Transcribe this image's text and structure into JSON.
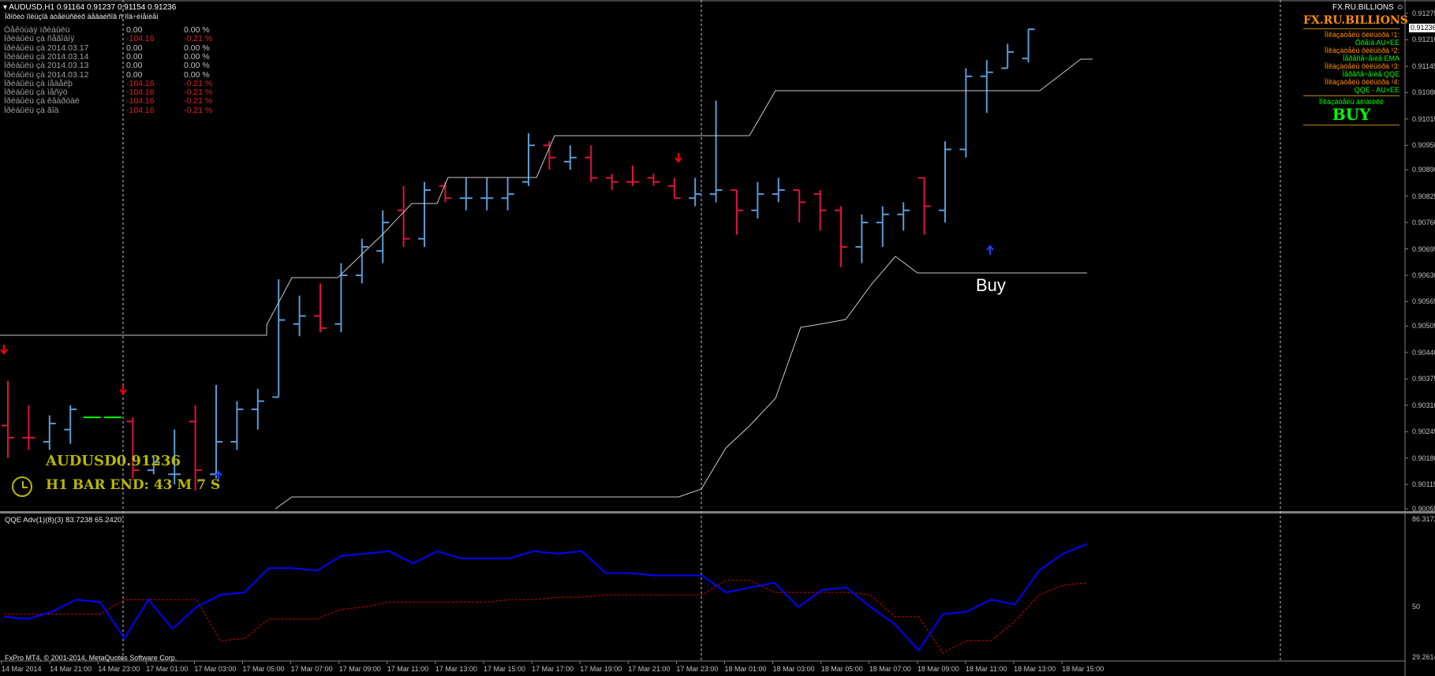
{
  "header": {
    "symbol_line": "AUDUSD,H1  0.91164 0.91237 0.91154 0.91236",
    "subtitle": "Ïðîôèò ïîëüçîâ àòåëüñêèõ äåâàéñîâ ñ ïîä÷èíåíèåì",
    "broker_label": "FX.RU.BILLIONS"
  },
  "stats": {
    "rows": [
      {
        "label": "Òåêóùàÿ ïðèáûëü",
        "value": "0.00",
        "pct": "0.00 %",
        "color": "#c0c0c0"
      },
      {
        "label": "Ïðèáûëü çà ñåãîäíÿ",
        "value": "-104.16",
        "pct": "-0.21 %",
        "color": "#e02020"
      },
      {
        "label": "Ïðèáûëü çà 2014.03.17",
        "value": "0.00",
        "pct": "0.00 %",
        "color": "#c0c0c0"
      },
      {
        "label": "Ïðèáûëü çà 2014.03.14",
        "value": "0.00",
        "pct": "0.00 %",
        "color": "#c0c0c0"
      },
      {
        "label": "Ïðèáûëü çà 2014.03.13",
        "value": "0.00",
        "pct": "0.00 %",
        "color": "#c0c0c0"
      },
      {
        "label": "Ïðèáûëü çà 2014.03.12",
        "value": "0.00",
        "pct": "0.00 %",
        "color": "#c0c0c0"
      },
      {
        "label": "Ïðèáûëü çà íåäåëþ",
        "value": "-104.16",
        "pct": "-0.21 %",
        "color": "#e02020"
      },
      {
        "label": "Ïðèáûëü çà ìåñÿö",
        "value": "-104.16",
        "pct": "-0.21 %",
        "color": "#e02020"
      },
      {
        "label": "Ïðèáûëü çà êâàðòàë",
        "value": "-104.16",
        "pct": "-0.21 %",
        "color": "#e02020"
      },
      {
        "label": "Ïðèáûëü çà ãîä",
        "value": "-104.16",
        "pct": "-0.21 %",
        "color": "#e02020"
      }
    ]
  },
  "overlay": {
    "symbol_price": "AUDUSD0.91236",
    "bar_end": "H1 BAR END: 43 M 7 S",
    "buy_label": "Buy",
    "clock_icon": "clock-icon"
  },
  "right_panel": {
    "title": "FX.RU.BILLIONS",
    "lines": [
      {
        "text": "Ïîêàçàòåëü ôèëüòðà ¹1:",
        "color": "#ff8c00"
      },
      {
        "text": "Òðåíä AU×EE",
        "color": "#00ff00"
      },
      {
        "text": "Ïîêàçàòåëü ôèëüòðà ¹2:",
        "color": "#ff8c00"
      },
      {
        "text": "Ïåðåñå÷åíèå EMA",
        "color": "#00ff00"
      },
      {
        "text": "Ïîêàçàòåëü ôèëüòðà ¹3:",
        "color": "#ff8c00"
      },
      {
        "text": "Ïåðåñå÷åíèå QQE",
        "color": "#00ff00"
      },
      {
        "text": "Ïîêàçàòåëü ôèëüòðà ¹4:",
        "color": "#ff8c00"
      },
      {
        "text": "QQE - AU×EE",
        "color": "#00ff00"
      }
    ],
    "signal_caption": "Ïîêàçàòåëü äèíàìèêè",
    "signal": "BUY"
  },
  "price_axis": {
    "labels": [
      "0.91275",
      "0.91210",
      "0.91145",
      "0.91080",
      "0.91015",
      "0.90950",
      "0.90890",
      "0.90825",
      "0.90760",
      "0.90695",
      "0.90630",
      "0.90565",
      "0.90505",
      "0.90440",
      "0.90375",
      "0.90310",
      "0.90245",
      "0.90180",
      "0.90115",
      "0.90055"
    ],
    "current_price": "0.91236"
  },
  "indicator": {
    "title": "QQE Adv(1)(8)(3) 83.7238 65.2420",
    "axis_labels": [
      "86.3172",
      "50",
      "29.2614"
    ]
  },
  "time_axis": {
    "labels": [
      "14 Mar 2014",
      "14 Mar 21:00",
      "14 Mar 23:00",
      "17 Mar 01:00",
      "17 Mar 03:00",
      "17 Mar 05:00",
      "17 Mar 07:00",
      "17 Mar 09:00",
      "17 Mar 11:00",
      "17 Mar 13:00",
      "17 Mar 15:00",
      "17 Mar 17:00",
      "17 Mar 19:00",
      "17 Mar 21:00",
      "17 Mar 23:00",
      "18 Mar 01:00",
      "18 Mar 03:00",
      "18 Mar 05:00",
      "18 Mar 07:00",
      "18 Mar 09:00",
      "18 Mar 11:00",
      "18 Mar 13:00",
      "18 Mar 15:00"
    ]
  },
  "footer": {
    "copyright": "FxPro MT4, © 2001-2014, MetaQuotes Software Corp."
  },
  "colors": {
    "bull": "#5b9bd5",
    "bear": "#dc143c",
    "qqe_fast": "#0000ff",
    "qqe_slow": "#cc0000",
    "envelope": "#c8c8c8",
    "gold": "#b8b800",
    "green": "#00ff00",
    "orange": "#ff8c00"
  },
  "chart_data": {
    "type": "candlestick",
    "symbol": "AUDUSD",
    "timeframe": "H1",
    "bars": [
      {
        "o": 0.9026,
        "h": 0.9037,
        "l": 0.9018,
        "c": 0.9023,
        "d": "bear"
      },
      {
        "o": 0.9023,
        "h": 0.9031,
        "l": 0.902,
        "c": 0.9023,
        "d": "bear"
      },
      {
        "o": 0.9022,
        "h": 0.90285,
        "l": 0.902,
        "c": 0.90265,
        "d": "bull"
      },
      {
        "o": 0.9025,
        "h": 0.9031,
        "l": 0.90215,
        "c": 0.903,
        "d": "bull"
      },
      {
        "o": 0.9028,
        "h": 0.9028,
        "l": 0.9028,
        "c": 0.9028,
        "d": "green"
      },
      {
        "o": 0.9028,
        "h": 0.9028,
        "l": 0.9028,
        "c": 0.9028,
        "d": "green"
      },
      {
        "o": 0.9027,
        "h": 0.9028,
        "l": 0.9013,
        "c": 0.9015,
        "d": "bear"
      },
      {
        "o": 0.9015,
        "h": 0.90185,
        "l": 0.9014,
        "c": 0.9017,
        "d": "bull"
      },
      {
        "o": 0.9014,
        "h": 0.9025,
        "l": 0.90115,
        "c": 0.9014,
        "d": "bull"
      },
      {
        "o": 0.9027,
        "h": 0.9031,
        "l": 0.901,
        "c": 0.9015,
        "d": "bear"
      },
      {
        "o": 0.9014,
        "h": 0.9036,
        "l": 0.9013,
        "c": 0.9022,
        "d": "bull"
      },
      {
        "o": 0.9022,
        "h": 0.9032,
        "l": 0.902,
        "c": 0.903,
        "d": "bull"
      },
      {
        "o": 0.903,
        "h": 0.9035,
        "l": 0.9025,
        "c": 0.9032,
        "d": "bull"
      },
      {
        "o": 0.9033,
        "h": 0.9062,
        "l": 0.9033,
        "c": 0.9052,
        "d": "bull"
      },
      {
        "o": 0.9051,
        "h": 0.9058,
        "l": 0.9048,
        "c": 0.9053,
        "d": "bull"
      },
      {
        "o": 0.9053,
        "h": 0.9061,
        "l": 0.9049,
        "c": 0.905,
        "d": "bear"
      },
      {
        "o": 0.9051,
        "h": 0.9066,
        "l": 0.9049,
        "c": 0.9063,
        "d": "bull"
      },
      {
        "o": 0.9063,
        "h": 0.9072,
        "l": 0.9061,
        "c": 0.907,
        "d": "bull"
      },
      {
        "o": 0.9069,
        "h": 0.9079,
        "l": 0.9066,
        "c": 0.9076,
        "d": "bull"
      },
      {
        "o": 0.9079,
        "h": 0.9085,
        "l": 0.907,
        "c": 0.9072,
        "d": "bear"
      },
      {
        "o": 0.9072,
        "h": 0.9086,
        "l": 0.907,
        "c": 0.9084,
        "d": "bull"
      },
      {
        "o": 0.9085,
        "h": 0.9086,
        "l": 0.9081,
        "c": 0.9082,
        "d": "bear"
      },
      {
        "o": 0.9082,
        "h": 0.9087,
        "l": 0.9079,
        "c": 0.9082,
        "d": "bull"
      },
      {
        "o": 0.9082,
        "h": 0.9087,
        "l": 0.9079,
        "c": 0.9082,
        "d": "bull"
      },
      {
        "o": 0.9082,
        "h": 0.9087,
        "l": 0.9079,
        "c": 0.9083,
        "d": "bull"
      },
      {
        "o": 0.9086,
        "h": 0.9098,
        "l": 0.9085,
        "c": 0.9095,
        "d": "bull"
      },
      {
        "o": 0.9095,
        "h": 0.9096,
        "l": 0.9089,
        "c": 0.9092,
        "d": "bear"
      },
      {
        "o": 0.9091,
        "h": 0.9095,
        "l": 0.9089,
        "c": 0.9092,
        "d": "bull"
      },
      {
        "o": 0.9092,
        "h": 0.9095,
        "l": 0.9086,
        "c": 0.9087,
        "d": "bear"
      },
      {
        "o": 0.9087,
        "h": 0.9088,
        "l": 0.9084,
        "c": 0.9086,
        "d": "bear"
      },
      {
        "o": 0.9086,
        "h": 0.909,
        "l": 0.9085,
        "c": 0.9086,
        "d": "bear"
      },
      {
        "o": 0.9087,
        "h": 0.9088,
        "l": 0.9085,
        "c": 0.9086,
        "d": "bear"
      },
      {
        "o": 0.9085,
        "h": 0.9087,
        "l": 0.9082,
        "c": 0.9082,
        "d": "bear"
      },
      {
        "o": 0.9082,
        "h": 0.9087,
        "l": 0.908,
        "c": 0.9083,
        "d": "bull"
      },
      {
        "o": 0.9083,
        "h": 0.9106,
        "l": 0.9081,
        "c": 0.9084,
        "d": "bull"
      },
      {
        "o": 0.9084,
        "h": 0.9084,
        "l": 0.9073,
        "c": 0.9079,
        "d": "bear"
      },
      {
        "o": 0.9079,
        "h": 0.9086,
        "l": 0.9077,
        "c": 0.9083,
        "d": "bull"
      },
      {
        "o": 0.9083,
        "h": 0.9087,
        "l": 0.9081,
        "c": 0.9084,
        "d": "bull"
      },
      {
        "o": 0.9084,
        "h": 0.9084,
        "l": 0.9076,
        "c": 0.9081,
        "d": "bear"
      },
      {
        "o": 0.9083,
        "h": 0.9084,
        "l": 0.9074,
        "c": 0.9079,
        "d": "bear"
      },
      {
        "o": 0.9079,
        "h": 0.908,
        "l": 0.9065,
        "c": 0.907,
        "d": "bear"
      },
      {
        "o": 0.907,
        "h": 0.9078,
        "l": 0.9066,
        "c": 0.9076,
        "d": "bull"
      },
      {
        "o": 0.9076,
        "h": 0.908,
        "l": 0.907,
        "c": 0.9078,
        "d": "bull"
      },
      {
        "o": 0.9078,
        "h": 0.9081,
        "l": 0.9074,
        "c": 0.9079,
        "d": "bull"
      },
      {
        "o": 0.9087,
        "h": 0.9087,
        "l": 0.9073,
        "c": 0.908,
        "d": "bear"
      },
      {
        "o": 0.9079,
        "h": 0.9096,
        "l": 0.9076,
        "c": 0.9094,
        "d": "bull"
      },
      {
        "o": 0.9094,
        "h": 0.9114,
        "l": 0.9092,
        "c": 0.9112,
        "d": "bull"
      },
      {
        "o": 0.9112,
        "h": 0.9116,
        "l": 0.9103,
        "c": 0.9113,
        "d": "bull"
      },
      {
        "o": 0.9114,
        "h": 0.912,
        "l": 0.9114,
        "c": 0.9118,
        "d": "bull"
      },
      {
        "o": 0.91164,
        "h": 0.91237,
        "l": 0.91154,
        "c": 0.91236,
        "d": "bull"
      }
    ],
    "qqe_fast": [
      46,
      45,
      48,
      53,
      52,
      37,
      53,
      41,
      50,
      55,
      56,
      66,
      66,
      65,
      71,
      72,
      73,
      68,
      73,
      70,
      70,
      70,
      73,
      72,
      73,
      64,
      64,
      63,
      63,
      63,
      56,
      58,
      60,
      50,
      57,
      58,
      50,
      43,
      32,
      47,
      48,
      53,
      51,
      65,
      72,
      76
    ],
    "qqe_slow": [
      47,
      47,
      47,
      47,
      47,
      53,
      53,
      53,
      53,
      36,
      37,
      45,
      45,
      45,
      49,
      50,
      52,
      52,
      52,
      52,
      52,
      53,
      53,
      54,
      54,
      55,
      55,
      55,
      55,
      55,
      61,
      61,
      56,
      56,
      56,
      56,
      55,
      46,
      46,
      31,
      36,
      36,
      44,
      55,
      59,
      60
    ]
  }
}
